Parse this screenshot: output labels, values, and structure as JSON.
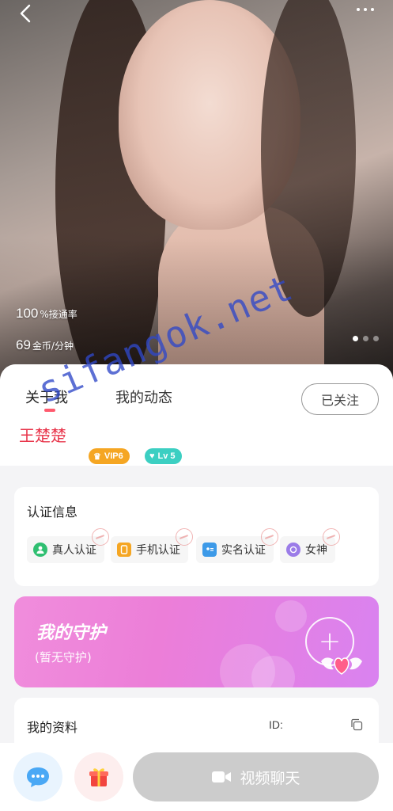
{
  "hero": {
    "answer_rate_value": "100",
    "answer_rate_label": "%接通率",
    "price_value": "69",
    "price_label": "金币/分钟",
    "carousel_active": 1,
    "carousel_count": 3
  },
  "tabs": {
    "about_me": "关于我",
    "my_feed": "我的动态"
  },
  "follow_button": "已关注",
  "user": {
    "name": "王楚楚",
    "vip_badge": "VIP6",
    "level_badge": "Lv 5"
  },
  "certification": {
    "title": "认证信息",
    "items": [
      "真人认证",
      "手机认证",
      "实名认证",
      "女神"
    ]
  },
  "guardian": {
    "title": "我的守护",
    "subtitle": "(暂无守护)",
    "add_symbol": "+"
  },
  "profile": {
    "title": "我的资料",
    "id_label": "ID:"
  },
  "bottom": {
    "video_chat": "视频聊天"
  },
  "watermark": "sifangok.net",
  "colors": {
    "accent_pink": "#ff5a6e",
    "name_red": "#e8344a",
    "vip_orange": "#f5a623",
    "level_teal": "#3ccfc2",
    "guard_gradient_start": "#f08ddc",
    "guard_gradient_end": "#d982f0",
    "video_button_disabled": "#cccccc"
  }
}
